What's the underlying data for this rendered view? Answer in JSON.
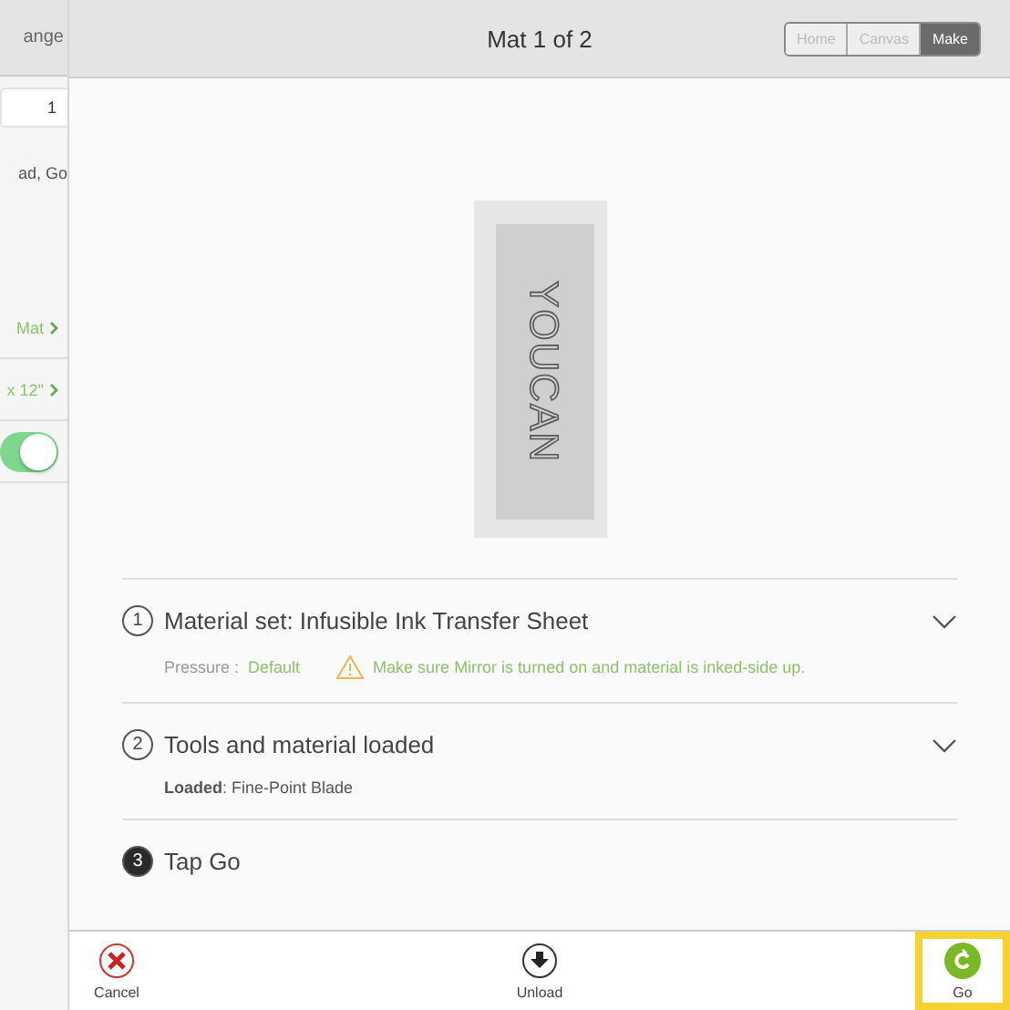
{
  "sidebar": {
    "header": "ange",
    "quantity": "1",
    "text": "ad, Go",
    "rows": [
      {
        "label": "Mat",
        "kind": "link"
      },
      {
        "label": "x 12\"",
        "kind": "link"
      },
      {
        "kind": "toggle",
        "on": true
      }
    ]
  },
  "header": {
    "title": "Mat 1 of 2",
    "tabs": [
      {
        "label": "Home",
        "selected": false
      },
      {
        "label": "Canvas",
        "selected": false
      },
      {
        "label": "Make",
        "selected": true
      }
    ]
  },
  "mat_preview": {
    "design_text": "YOUCAN"
  },
  "steps": [
    {
      "number": "1",
      "title": "Material set: Infusible Ink Transfer Sheet",
      "active": false,
      "expandable": true,
      "pressure_label": "Pressure :",
      "pressure_value": "Default",
      "warning": "Make sure Mirror is turned on and material is inked-side up."
    },
    {
      "number": "2",
      "title": "Tools and material loaded",
      "active": false,
      "expandable": true,
      "loaded_label": "Loaded",
      "loaded_value": ": Fine-Point Blade"
    },
    {
      "number": "3",
      "title": "Tap Go",
      "active": true,
      "expandable": false
    }
  ],
  "toolbar": [
    {
      "kind": "cancel",
      "label": "Cancel",
      "highlighted": false
    },
    {
      "kind": "unload",
      "label": "Unload",
      "highlighted": false
    },
    {
      "kind": "go",
      "label": "Go",
      "highlighted": true
    }
  ]
}
